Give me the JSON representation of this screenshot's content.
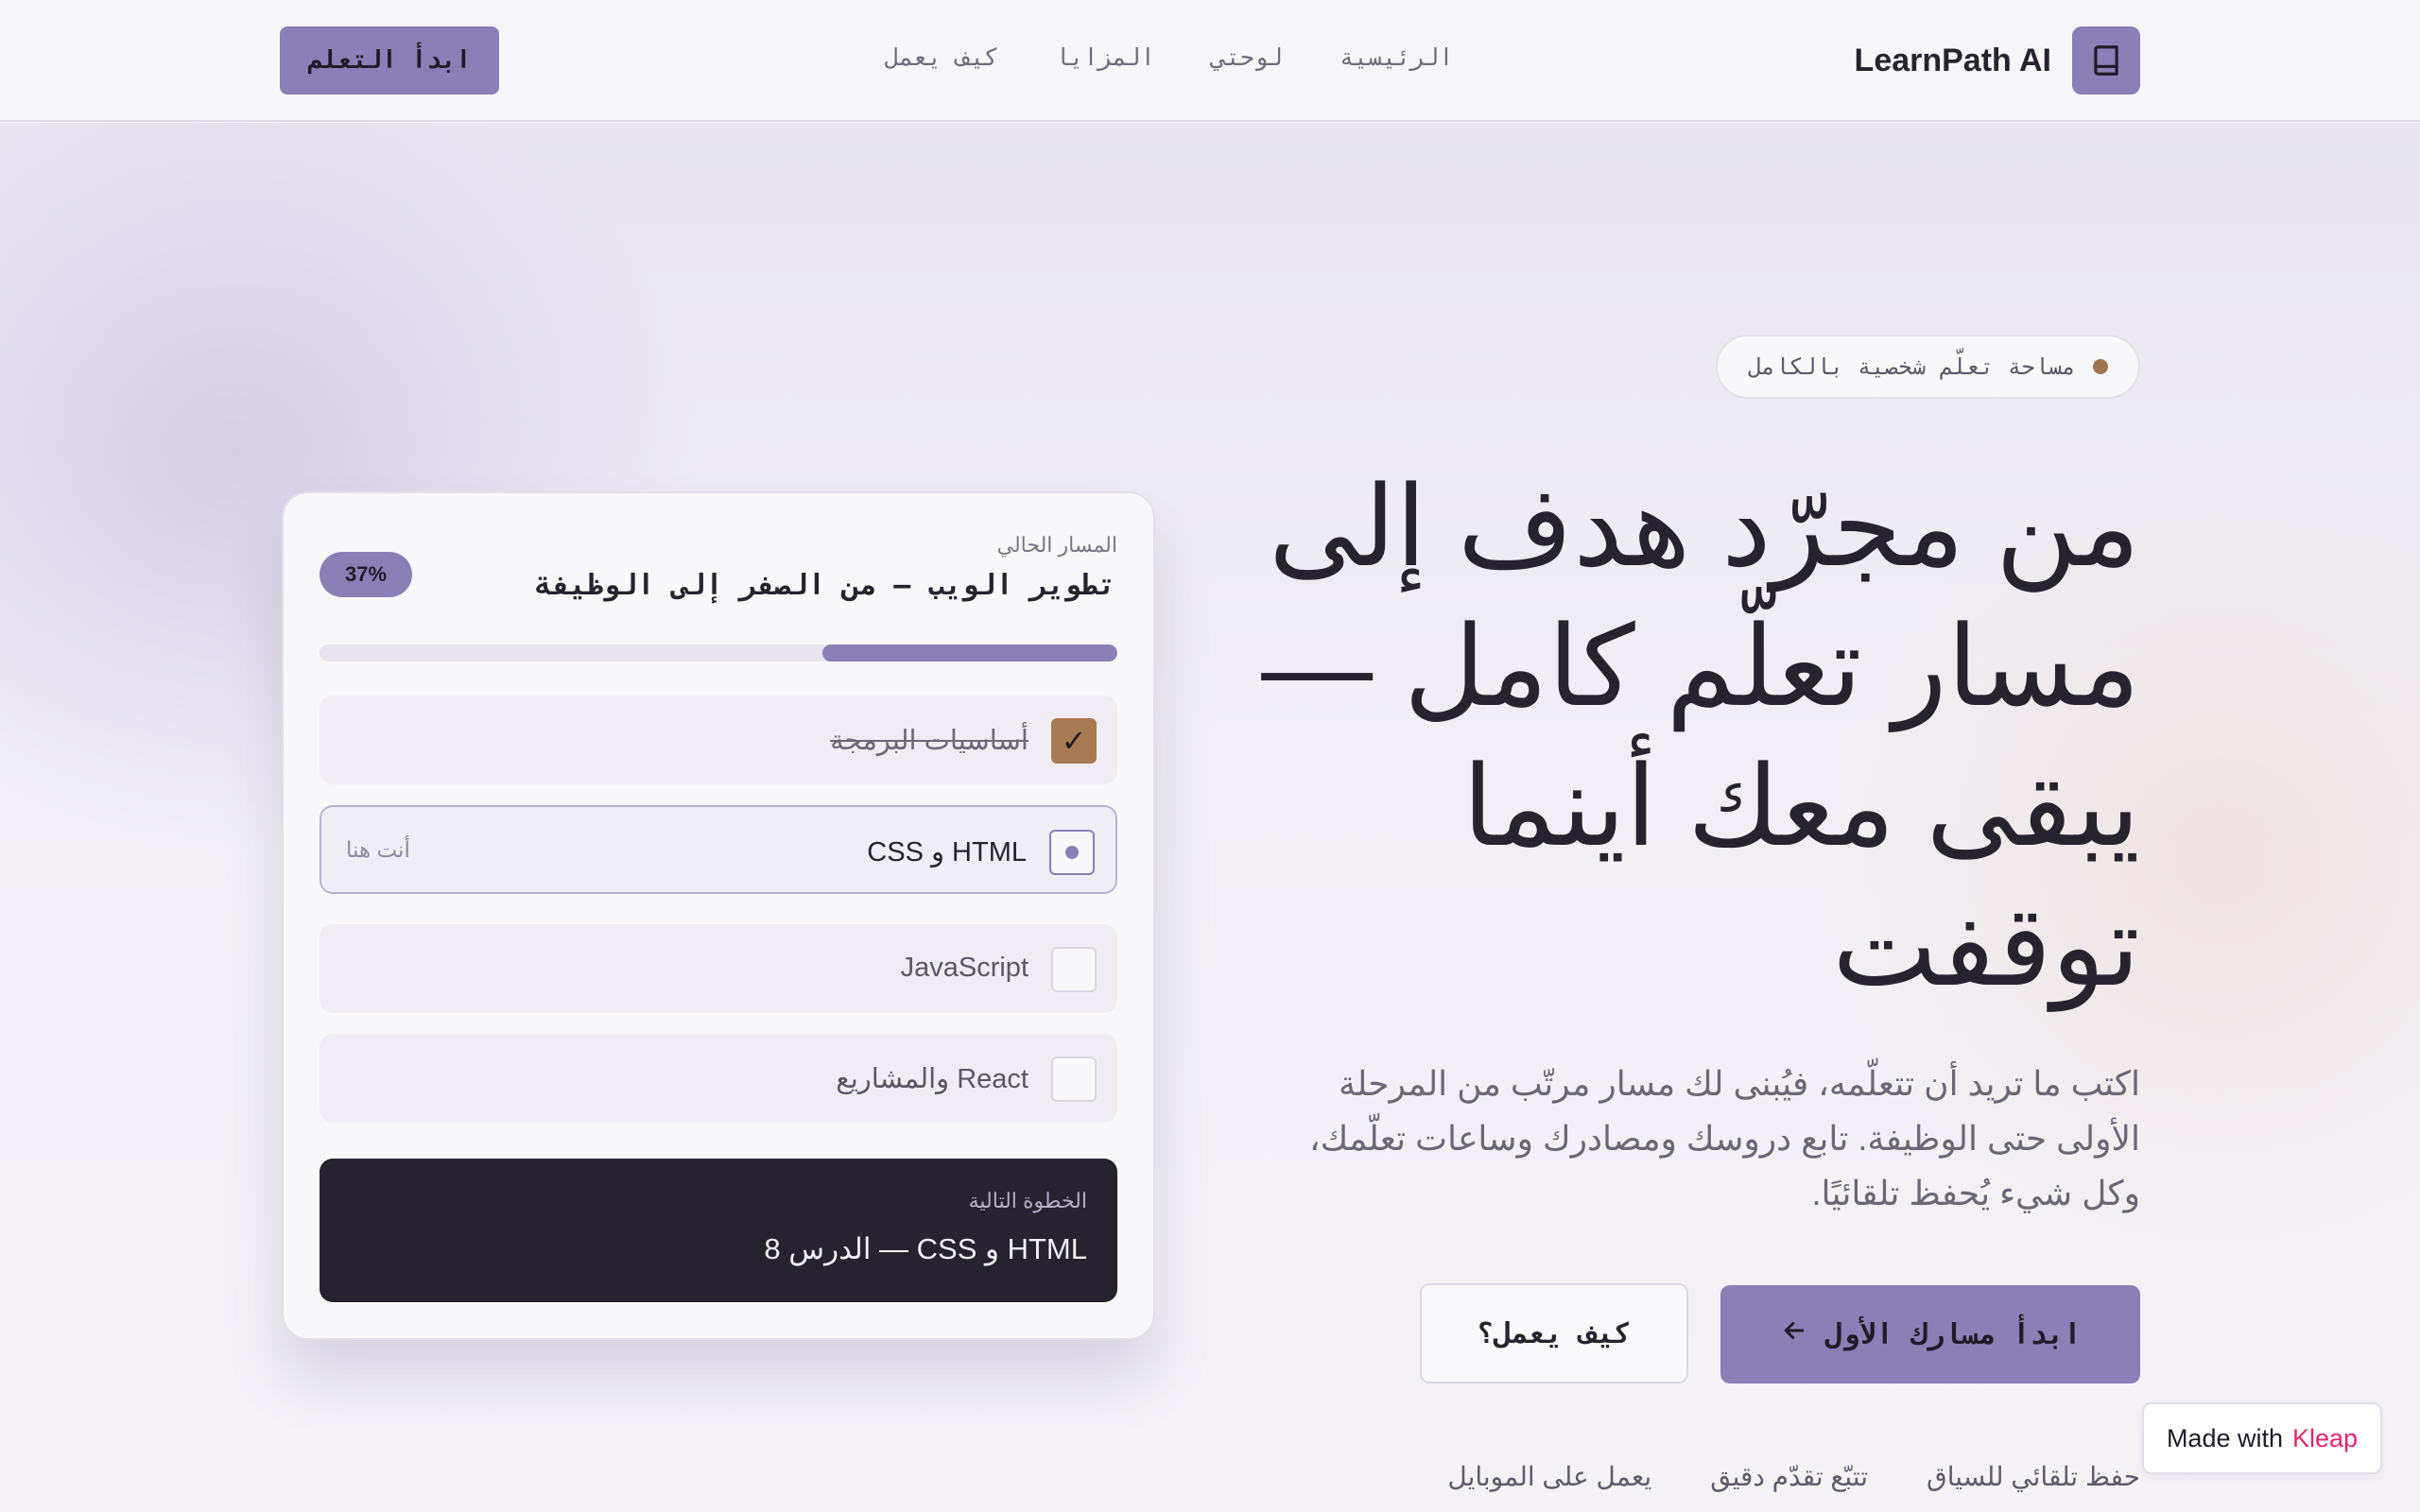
{
  "header": {
    "brand_name": "LearnPath AI",
    "logo_icon": "book-icon",
    "nav": [
      "الرئيسية",
      "لوحتي",
      "المزايا",
      "كيف يعمل"
    ],
    "cta_label": "ابدأ التعلم"
  },
  "hero": {
    "tagline": "مساحة تعلّم شخصية بالكامل",
    "title": "من مجرّد هدف إلى مسار تعلّم كامل — يبقى معك أينما توقفت",
    "description": "اكتب ما تريد أن تتعلّمه، فيُبنى لك مسار مرتّب من المرحلة الأولى حتى الوظيفة. تابع دروسك ومصادرك وساعات تعلّمك، وكل شيء يُحفظ تلقائيًا.",
    "primary_button": "ابدأ مسارك الأول",
    "primary_icon": "arrow-left-icon",
    "secondary_button": "كيف يعمل؟",
    "features": [
      "حفظ تلقائي للسياق",
      "تتبّع تقدّم دقيق",
      "يعمل على الموبايل"
    ]
  },
  "card": {
    "label": "المسار الحالي",
    "title": "تطوير الويب — من الصفر إلى الوظيفة",
    "progress_text": "37%",
    "progress": 0.37,
    "steps": [
      {
        "label": "أساسيات البرمجة",
        "status": "done"
      },
      {
        "label": "HTML و CSS",
        "status": "current",
        "note": "أنت هنا"
      },
      {
        "label": "JavaScript",
        "status": "todo"
      },
      {
        "label": "React والمشاريع",
        "status": "todo"
      }
    ],
    "next_label": "الخطوة التالية",
    "next_text": "HTML و CSS — الدرس 8"
  },
  "badge": {
    "made_with": "Made with",
    "brand": "Kleap"
  },
  "colors": {
    "accent": "#8a7fb6",
    "dark": "#26232f",
    "done": "#a87a52",
    "background": "#f3f1f6"
  }
}
